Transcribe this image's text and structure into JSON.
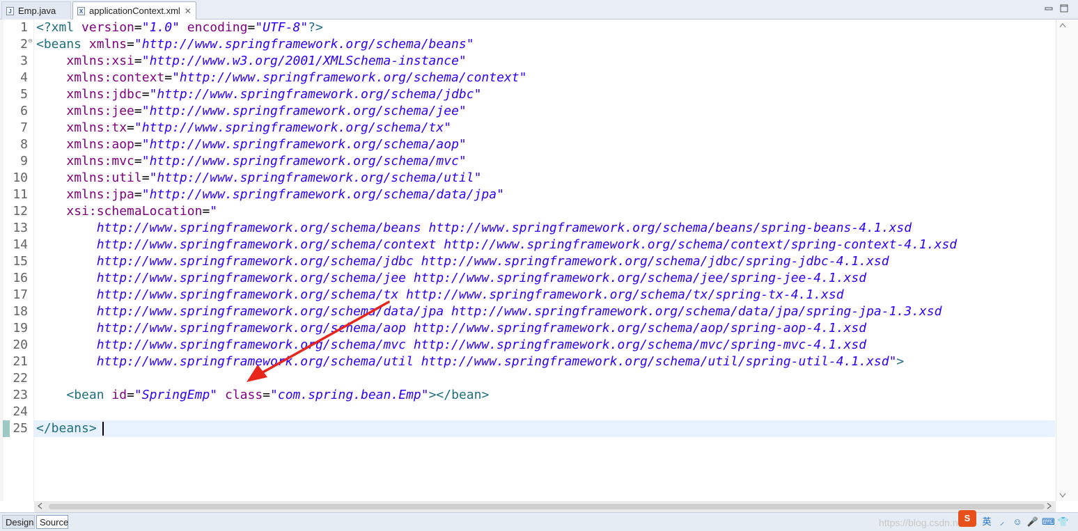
{
  "tabs": [
    {
      "label": "Emp.java",
      "icon": "java-file-icon",
      "icon_text": "J"
    },
    {
      "label": "applicationContext.xml",
      "icon": "xml-file-icon",
      "icon_text": "X",
      "active": true
    }
  ],
  "window_controls": {
    "minimize": "▭",
    "maximize": "▢"
  },
  "editor": {
    "file": "applicationContext.xml",
    "current_line": 25,
    "lines": [
      {
        "n": "1",
        "fold": "",
        "segs": [
          {
            "t": "<?xml ",
            "c": "tag"
          },
          {
            "t": "version",
            "c": "attr"
          },
          {
            "t": "=",
            "c": ""
          },
          {
            "t": "\"1.0\"",
            "c": "str"
          },
          {
            "t": " ",
            "c": ""
          },
          {
            "t": "encoding",
            "c": "attr"
          },
          {
            "t": "=",
            "c": ""
          },
          {
            "t": "\"UTF-8\"",
            "c": "str"
          },
          {
            "t": "?>",
            "c": "tag"
          }
        ]
      },
      {
        "n": "2",
        "fold": "⊖",
        "segs": [
          {
            "t": "<beans ",
            "c": "tag"
          },
          {
            "t": "xmlns",
            "c": "attr"
          },
          {
            "t": "=",
            "c": ""
          },
          {
            "t": "\"http://www.springframework.org/schema/beans\"",
            "c": "str"
          }
        ]
      },
      {
        "n": "3",
        "fold": "",
        "segs": [
          {
            "t": "    ",
            "c": ""
          },
          {
            "t": "xmlns:xsi",
            "c": "attr"
          },
          {
            "t": "=",
            "c": ""
          },
          {
            "t": "\"http://www.w3.org/2001/XMLSchema-instance\"",
            "c": "str"
          }
        ]
      },
      {
        "n": "4",
        "fold": "",
        "segs": [
          {
            "t": "    ",
            "c": ""
          },
          {
            "t": "xmlns:context",
            "c": "attr"
          },
          {
            "t": "=",
            "c": ""
          },
          {
            "t": "\"http://www.springframework.org/schema/context\"",
            "c": "str"
          }
        ]
      },
      {
        "n": "5",
        "fold": "",
        "segs": [
          {
            "t": "    ",
            "c": ""
          },
          {
            "t": "xmlns:jdbc",
            "c": "attr"
          },
          {
            "t": "=",
            "c": ""
          },
          {
            "t": "\"http://www.springframework.org/schema/jdbc\"",
            "c": "str"
          }
        ]
      },
      {
        "n": "6",
        "fold": "",
        "segs": [
          {
            "t": "    ",
            "c": ""
          },
          {
            "t": "xmlns:jee",
            "c": "attr"
          },
          {
            "t": "=",
            "c": ""
          },
          {
            "t": "\"http://www.springframework.org/schema/jee\"",
            "c": "str"
          }
        ]
      },
      {
        "n": "7",
        "fold": "",
        "segs": [
          {
            "t": "    ",
            "c": ""
          },
          {
            "t": "xmlns:tx",
            "c": "attr"
          },
          {
            "t": "=",
            "c": ""
          },
          {
            "t": "\"http://www.springframework.org/schema/tx\"",
            "c": "str"
          }
        ]
      },
      {
        "n": "8",
        "fold": "",
        "segs": [
          {
            "t": "    ",
            "c": ""
          },
          {
            "t": "xmlns:aop",
            "c": "attr"
          },
          {
            "t": "=",
            "c": ""
          },
          {
            "t": "\"http://www.springframework.org/schema/aop\"",
            "c": "str"
          }
        ]
      },
      {
        "n": "9",
        "fold": "",
        "segs": [
          {
            "t": "    ",
            "c": ""
          },
          {
            "t": "xmlns:mvc",
            "c": "attr"
          },
          {
            "t": "=",
            "c": ""
          },
          {
            "t": "\"http://www.springframework.org/schema/mvc\"",
            "c": "str"
          }
        ]
      },
      {
        "n": "10",
        "fold": "",
        "segs": [
          {
            "t": "    ",
            "c": ""
          },
          {
            "t": "xmlns:util",
            "c": "attr"
          },
          {
            "t": "=",
            "c": ""
          },
          {
            "t": "\"http://www.springframework.org/schema/util\"",
            "c": "str"
          }
        ]
      },
      {
        "n": "11",
        "fold": "",
        "segs": [
          {
            "t": "    ",
            "c": ""
          },
          {
            "t": "xmlns:jpa",
            "c": "attr"
          },
          {
            "t": "=",
            "c": ""
          },
          {
            "t": "\"http://www.springframework.org/schema/data/jpa\"",
            "c": "str"
          }
        ]
      },
      {
        "n": "12",
        "fold": "",
        "segs": [
          {
            "t": "    ",
            "c": ""
          },
          {
            "t": "xsi:schemaLocation",
            "c": "attr"
          },
          {
            "t": "=",
            "c": ""
          },
          {
            "t": "\"",
            "c": "str"
          }
        ]
      },
      {
        "n": "13",
        "fold": "",
        "segs": [
          {
            "t": "        ",
            "c": ""
          },
          {
            "t": "http://www.springframework.org/schema/beans http://www.springframework.org/schema/beans/spring-beans-4.1.xsd",
            "c": "str"
          }
        ]
      },
      {
        "n": "14",
        "fold": "",
        "segs": [
          {
            "t": "        ",
            "c": ""
          },
          {
            "t": "http://www.springframework.org/schema/context http://www.springframework.org/schema/context/spring-context-4.1.xsd",
            "c": "str"
          }
        ]
      },
      {
        "n": "15",
        "fold": "",
        "segs": [
          {
            "t": "        ",
            "c": ""
          },
          {
            "t": "http://www.springframework.org/schema/jdbc http://www.springframework.org/schema/jdbc/spring-jdbc-4.1.xsd",
            "c": "str"
          }
        ]
      },
      {
        "n": "16",
        "fold": "",
        "segs": [
          {
            "t": "        ",
            "c": ""
          },
          {
            "t": "http://www.springframework.org/schema/jee http://www.springframework.org/schema/jee/spring-jee-4.1.xsd",
            "c": "str"
          }
        ]
      },
      {
        "n": "17",
        "fold": "",
        "segs": [
          {
            "t": "        ",
            "c": ""
          },
          {
            "t": "http://www.springframework.org/schema/tx http://www.springframework.org/schema/tx/spring-tx-4.1.xsd",
            "c": "str"
          }
        ]
      },
      {
        "n": "18",
        "fold": "",
        "segs": [
          {
            "t": "        ",
            "c": ""
          },
          {
            "t": "http://www.springframework.org/schema/data/jpa http://www.springframework.org/schema/data/jpa/spring-jpa-1.3.xsd",
            "c": "str"
          }
        ]
      },
      {
        "n": "19",
        "fold": "",
        "segs": [
          {
            "t": "        ",
            "c": ""
          },
          {
            "t": "http://www.springframework.org/schema/aop http://www.springframework.org/schema/aop/spring-aop-4.1.xsd",
            "c": "str"
          }
        ]
      },
      {
        "n": "20",
        "fold": "",
        "segs": [
          {
            "t": "        ",
            "c": ""
          },
          {
            "t": "http://www.springframework.org/schema/mvc http://www.springframework.org/schema/mvc/spring-mvc-4.1.xsd",
            "c": "str"
          }
        ]
      },
      {
        "n": "21",
        "fold": "",
        "segs": [
          {
            "t": "        ",
            "c": ""
          },
          {
            "t": "http://www.springframework.org/schema/util http://www.springframework.org/schema/util/spring-util-4.1.xsd\"",
            "c": "str"
          },
          {
            "t": ">",
            "c": "tag"
          }
        ]
      },
      {
        "n": "22",
        "fold": "",
        "segs": []
      },
      {
        "n": "23",
        "fold": "",
        "segs": [
          {
            "t": "    ",
            "c": ""
          },
          {
            "t": "<bean ",
            "c": "tag"
          },
          {
            "t": "id",
            "c": "attr"
          },
          {
            "t": "=",
            "c": ""
          },
          {
            "t": "\"SpringEmp\"",
            "c": "str"
          },
          {
            "t": " ",
            "c": ""
          },
          {
            "t": "class",
            "c": "attr"
          },
          {
            "t": "=",
            "c": ""
          },
          {
            "t": "\"com.spring.bean.Emp\"",
            "c": "str"
          },
          {
            "t": "></bean>",
            "c": "tag"
          }
        ]
      },
      {
        "n": "24",
        "fold": "",
        "segs": []
      },
      {
        "n": "25",
        "fold": "",
        "segs": [
          {
            "t": "</beans>",
            "c": "tag"
          }
        ]
      }
    ]
  },
  "bottom_tabs": [
    {
      "label": "Design"
    },
    {
      "label": "Source",
      "active": true
    }
  ],
  "scroll": {
    "left": "<",
    "right": ">",
    "up": "^",
    "down": "v"
  },
  "watermark": "https://blog.csdn.net/...",
  "tray": [
    "S",
    "英",
    "⸝",
    "☺",
    "🎤",
    "⌨",
    "👕",
    "⠿"
  ],
  "colors": {
    "tag": "#1f6e80",
    "attr": "#7f007f",
    "string": "#2a00ff",
    "annotation_arrow": "#e8261c",
    "current_line": "#e8f2fe"
  }
}
